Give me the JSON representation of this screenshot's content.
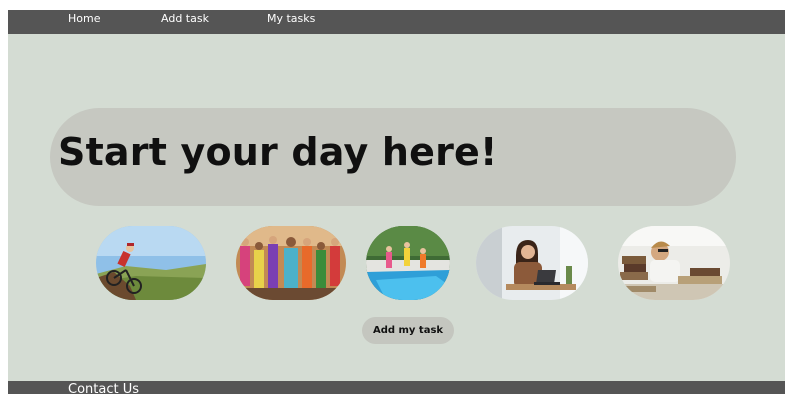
{
  "nav": {
    "items": [
      {
        "label": "Home"
      },
      {
        "label": "Add task"
      },
      {
        "label": "My tasks"
      }
    ]
  },
  "hero": {
    "title": "Start your day here!"
  },
  "activities": [
    {
      "image": "cycling-photo"
    },
    {
      "image": "dance-class-photo"
    },
    {
      "image": "swimming-pool-photo"
    },
    {
      "image": "laptop-work-photo"
    },
    {
      "image": "studying-books-photo"
    }
  ],
  "actions": {
    "add_task_label": "Add my task"
  },
  "footer": {
    "contact_label": "Contact Us"
  },
  "colors": {
    "page_background": "#d4dcd3",
    "bar_background": "#555555",
    "pill_background": "#c6c8c1",
    "nav_text": "#ffffff"
  }
}
